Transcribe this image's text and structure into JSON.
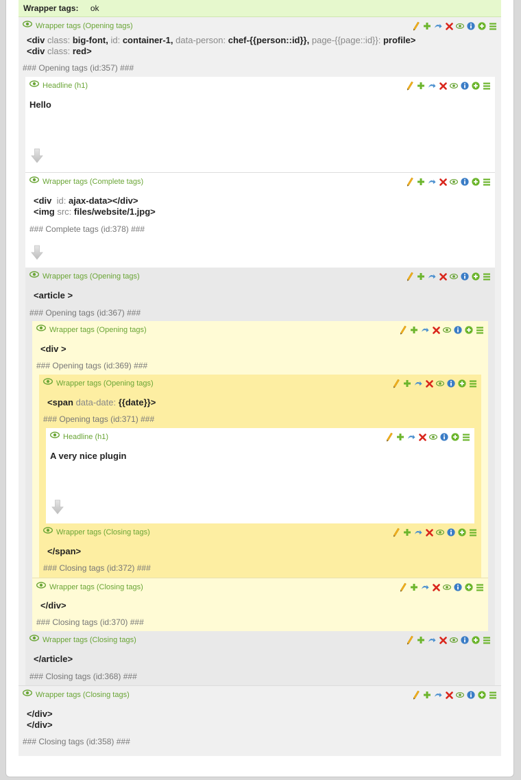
{
  "status": {
    "label": "Wrapper tags:",
    "value": "ok"
  },
  "elements": {
    "w357": {
      "title": "Wrapper tags (Opening tags)",
      "comment": "### Opening tags (id:357) ###"
    },
    "h_hello": {
      "title": "Headline (h1)",
      "text": "Hello"
    },
    "w378": {
      "title": "Wrapper tags (Complete tags)",
      "comment": "### Complete tags (id:378) ###"
    },
    "w367": {
      "title": "Wrapper tags (Opening tags)",
      "comment": "### Opening tags (id:367) ###"
    },
    "w369": {
      "title": "Wrapper tags (Opening tags)",
      "comment": "### Opening tags (id:369) ###"
    },
    "w371": {
      "title": "Wrapper tags (Opening tags)",
      "comment": "### Opening tags (id:371) ###"
    },
    "h_plugin": {
      "title": "Headline (h1)",
      "text": "A very nice plugin"
    },
    "w372": {
      "title": "Wrapper tags (Closing tags)",
      "comment": "### Closing tags (id:372) ###"
    },
    "w370": {
      "title": "Wrapper tags (Closing tags)",
      "comment": "### Closing tags (id:370) ###"
    },
    "w368": {
      "title": "Wrapper tags (Closing tags)",
      "comment": "### Closing tags (id:368) ###"
    },
    "w358": {
      "title": "Wrapper tags (Closing tags)",
      "comment": "### Closing tags (id:358) ###"
    }
  },
  "code": {
    "w357": {
      "l1": {
        "open": "<div",
        "a1": "class:",
        "v1": "big-font,",
        "a2": "id:",
        "v2": "container-1,",
        "a3": "data-person:",
        "v3": "chef-{{person::id}},",
        "a4": "page-{{page::id}}:",
        "v4": "profile>"
      },
      "l2": {
        "open": "<div",
        "a1": "class:",
        "v1": "red>"
      }
    },
    "w378": {
      "l1": {
        "open": "<div",
        "a1": "id:",
        "v1": "ajax-data></div>"
      },
      "l2": {
        "open": "<img",
        "a1": "src:",
        "v1": "files/website/1.jpg>"
      }
    },
    "w367": "<article >",
    "w369": "<div >",
    "w371": {
      "open": "<span",
      "a1": "data-date:",
      "v1": "{{date}}>"
    },
    "w372": "</span>",
    "w370": "</div>",
    "w368": "</article>",
    "w358": {
      "l1": "</div>",
      "l2": "</div>"
    }
  },
  "actions": [
    "edit-icon",
    "add-icon",
    "move-icon",
    "delete-icon",
    "toggle-visibility-icon",
    "info-icon",
    "paste-after-icon",
    "drag-handle-icon"
  ],
  "colors": {
    "status_bg": "#e6f8cd",
    "label_green": "#6aa536",
    "level0_bg": "#f0f0f0",
    "level1_bg": "#e9e9e9",
    "level2_bg": "#fffbd5",
    "level3_bg": "#fdeea2",
    "content_bg": "#ffffff"
  }
}
